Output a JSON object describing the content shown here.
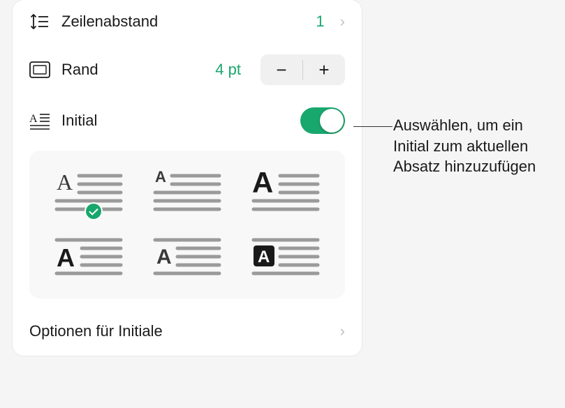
{
  "line_spacing": {
    "label": "Zeilenabstand",
    "value": "1"
  },
  "margin": {
    "label": "Rand",
    "value": "4 pt",
    "minus": "−",
    "plus": "+"
  },
  "initial": {
    "label": "Initial",
    "toggle_on": true
  },
  "initial_styles": {
    "selected_index": 0,
    "options": [
      "serif-small-raised",
      "sans-small-raised",
      "sans-bold-raised",
      "sans-bold-dropped",
      "sans-dropped",
      "sans-inverse-dropped"
    ]
  },
  "options_link": {
    "label": "Optionen für Initiale"
  },
  "callout": {
    "text": "Auswählen, um ein Initial zum aktuellen Absatz hinzuzufügen"
  }
}
